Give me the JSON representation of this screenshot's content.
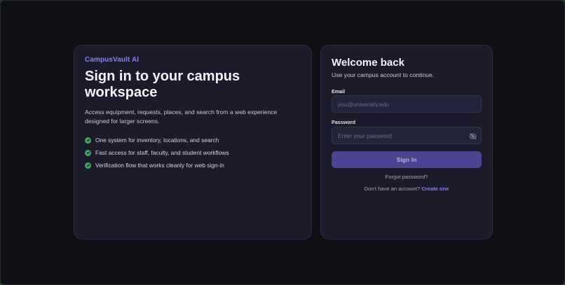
{
  "brand": {
    "name": "CampusVault AI",
    "accent_color": "#8b7ff0"
  },
  "hero": {
    "title": "Sign in to your campus workspace",
    "description": "Access equipment, requests, places, and search from a web experience designed for larger screens.",
    "features": [
      {
        "text": "One system for inventory, locations, and search",
        "icon": "check-circle-icon"
      },
      {
        "text": "Fast access for staff, faculty, and student workflows",
        "icon": "check-circle-icon"
      },
      {
        "text": "Verification flow that works cleanly for web sign-in",
        "icon": "check-circle-icon"
      }
    ],
    "check_color": "#3fa55f"
  },
  "signin": {
    "title": "Welcome back",
    "subtitle": "Use your campus account to continue.",
    "email": {
      "label": "Email",
      "placeholder": "you@university.edu",
      "value": ""
    },
    "password": {
      "label": "Password",
      "placeholder": "Enter your password",
      "value": "",
      "toggle_icon": "eye-off-icon"
    },
    "submit_label": "Sign In",
    "submit_color": "#4c4493",
    "forgot_label": "Forgot password?",
    "signup_prompt": "Don't have an account?",
    "signup_link": "Create one"
  }
}
